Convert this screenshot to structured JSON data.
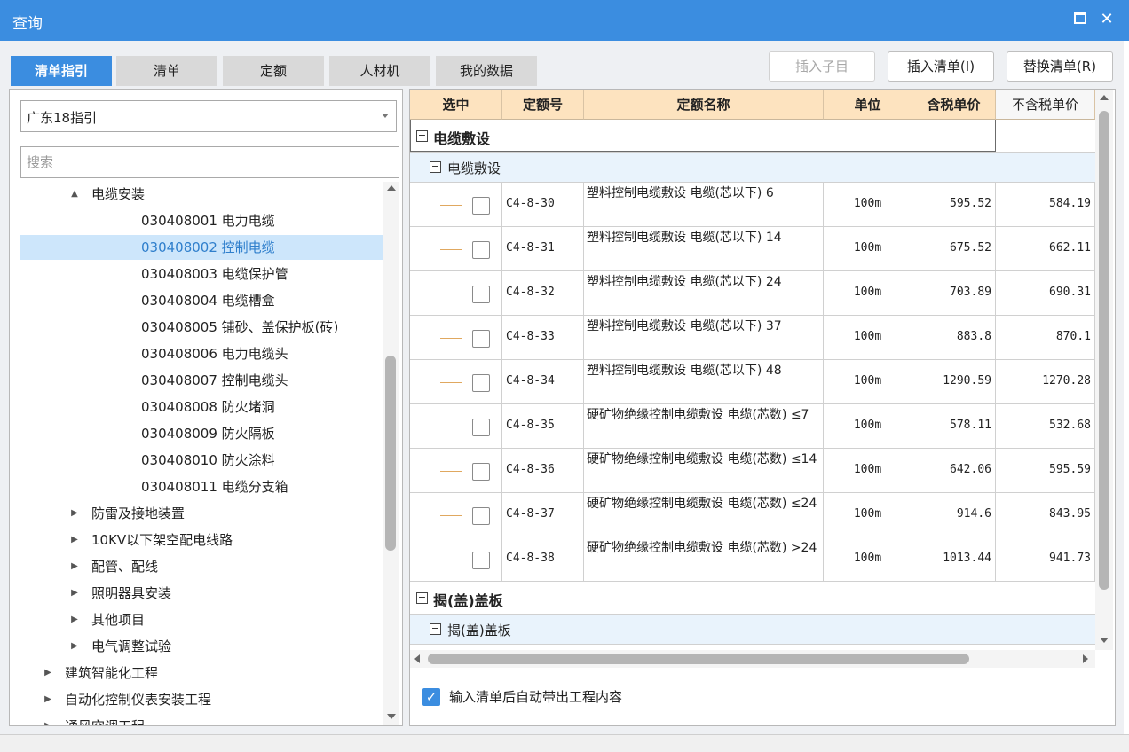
{
  "window": {
    "title": "查询"
  },
  "tabs": [
    {
      "label": "清单指引",
      "active": true
    },
    {
      "label": "清单",
      "active": false
    },
    {
      "label": "定额",
      "active": false
    },
    {
      "label": "人材机",
      "active": false
    },
    {
      "label": "我的数据",
      "active": false
    }
  ],
  "toolbar": {
    "insert_child": "插入子目",
    "insert_list": "插入清单(I)",
    "replace_list": "替换清单(R)"
  },
  "left": {
    "combo_value": "广东18指引",
    "search_placeholder": "搜索",
    "tree": [
      {
        "label": "电缆安装",
        "level": 2,
        "toggle": "▲"
      },
      {
        "label": "030408001  电力电缆",
        "level": 3
      },
      {
        "label": "030408002  控制电缆",
        "level": 3,
        "selected": true
      },
      {
        "label": "030408003  电缆保护管",
        "level": 3
      },
      {
        "label": "030408004  电缆槽盒",
        "level": 3
      },
      {
        "label": "030408005  铺砂、盖保护板(砖)",
        "level": 3
      },
      {
        "label": "030408006  电力电缆头",
        "level": 3
      },
      {
        "label": "030408007  控制电缆头",
        "level": 3
      },
      {
        "label": "030408008  防火堵洞",
        "level": 3
      },
      {
        "label": "030408009  防火隔板",
        "level": 3
      },
      {
        "label": "030408010  防火涂料",
        "level": 3
      },
      {
        "label": "030408011  电缆分支箱",
        "level": 3
      },
      {
        "label": "防雷及接地装置",
        "level": 2,
        "toggle": "▶"
      },
      {
        "label": "10KV以下架空配电线路",
        "level": 2,
        "toggle": "▶"
      },
      {
        "label": "配管、配线",
        "level": 2,
        "toggle": "▶"
      },
      {
        "label": "照明器具安装",
        "level": 2,
        "toggle": "▶"
      },
      {
        "label": "其他项目",
        "level": 2,
        "toggle": "▶"
      },
      {
        "label": "电气调整试验",
        "level": 2,
        "toggle": "▶"
      },
      {
        "label": "建筑智能化工程",
        "level": 1,
        "toggle": "▶"
      },
      {
        "label": "自动化控制仪表安装工程",
        "level": 1,
        "toggle": "▶"
      },
      {
        "label": "通风空调工程",
        "level": 1,
        "toggle": "▶"
      }
    ]
  },
  "grid": {
    "columns": [
      "选中",
      "定额号",
      "定额名称",
      "单位",
      "含税单价",
      "不含税单价"
    ],
    "group1_label": "电缆敷设",
    "group1_sub_label": "电缆敷设",
    "rows": [
      {
        "code": "C4-8-30",
        "name": "塑料控制电缆敷设 电缆(芯以下) 6",
        "unit": "100m",
        "price_tax": "595.52",
        "price_notax": "584.19"
      },
      {
        "code": "C4-8-31",
        "name": "塑料控制电缆敷设 电缆(芯以下) 14",
        "unit": "100m",
        "price_tax": "675.52",
        "price_notax": "662.11"
      },
      {
        "code": "C4-8-32",
        "name": "塑料控制电缆敷设 电缆(芯以下) 24",
        "unit": "100m",
        "price_tax": "703.89",
        "price_notax": "690.31"
      },
      {
        "code": "C4-8-33",
        "name": "塑料控制电缆敷设 电缆(芯以下) 37",
        "unit": "100m",
        "price_tax": "883.8",
        "price_notax": "870.1"
      },
      {
        "code": "C4-8-34",
        "name": "塑料控制电缆敷设 电缆(芯以下) 48",
        "unit": "100m",
        "price_tax": "1290.59",
        "price_notax": "1270.28"
      },
      {
        "code": "C4-8-35",
        "name": "硬矿物绝缘控制电缆敷设 电缆(芯数) ≤7",
        "unit": "100m",
        "price_tax": "578.11",
        "price_notax": "532.68"
      },
      {
        "code": "C4-8-36",
        "name": "硬矿物绝缘控制电缆敷设 电缆(芯数) ≤14",
        "unit": "100m",
        "price_tax": "642.06",
        "price_notax": "595.59"
      },
      {
        "code": "C4-8-37",
        "name": "硬矿物绝缘控制电缆敷设 电缆(芯数) ≤24",
        "unit": "100m",
        "price_tax": "914.6",
        "price_notax": "843.95"
      },
      {
        "code": "C4-8-38",
        "name": "硬矿物绝缘控制电缆敷设 电缆(芯数) >24",
        "unit": "100m",
        "price_tax": "1013.44",
        "price_notax": "941.73"
      }
    ],
    "group2_label": "揭(盖)盖板",
    "group2_sub_label": "揭(盖)盖板"
  },
  "options": {
    "auto_bring_content": "输入清单后自动带出工程内容",
    "auto_checked": true
  },
  "colors": {
    "accent": "#3b8de0",
    "header_bg": "#fde3bf",
    "selected_row": "#cde6fb",
    "sub_group_bg": "#e9f3fc"
  }
}
